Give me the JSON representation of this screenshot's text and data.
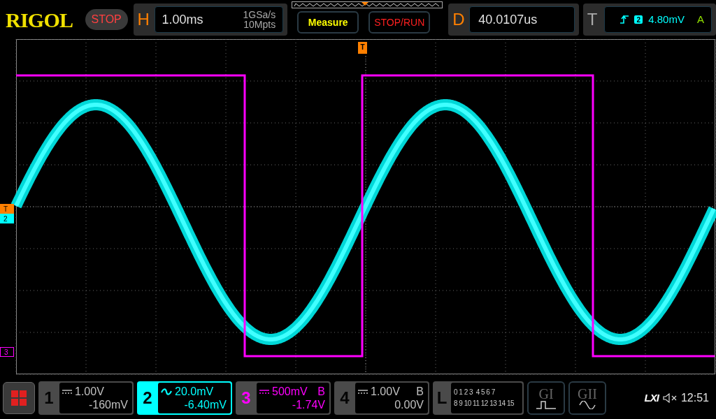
{
  "header": {
    "logo": "RIGOL",
    "run_state": "STOP",
    "horizontal": {
      "label": "H",
      "timebase": "1.00ms",
      "sample_rate": "1GSa/s",
      "memory_depth": "10Mpts"
    },
    "buttons": [
      {
        "label": "Measure",
        "kind": "measure"
      },
      {
        "label": "STOP/RUN",
        "kind": "stoprun"
      }
    ],
    "delay": {
      "label": "D",
      "value": "40.0107us"
    },
    "trigger": {
      "label": "T",
      "source": "2",
      "trigger_level": "4.80mV",
      "mode": "A"
    }
  },
  "plot": {
    "trigger_position_marker": "T",
    "markers": [
      {
        "label": "T",
        "color": "#ff8000"
      },
      {
        "label": "2",
        "color": "#00ffff"
      },
      {
        "label": "3",
        "color": "#ff00ff"
      }
    ]
  },
  "channels": [
    {
      "number": "1",
      "kind": "dc",
      "scale": "1.00V",
      "offset": "-160mV",
      "enabled": false,
      "selected": false
    },
    {
      "number": "2",
      "kind": "ac",
      "scale": "20.0mV",
      "offset": "-6.40mV",
      "enabled": true,
      "selected": true,
      "color": "#00ffff"
    },
    {
      "number": "3",
      "kind": "dc",
      "scale": "500mV",
      "offset": "-1.74V",
      "bandwidth": "B",
      "enabled": true,
      "selected": false,
      "color": "#ff00ff"
    },
    {
      "number": "4",
      "kind": "dc",
      "scale": "1.00V",
      "offset": "0.00V",
      "bandwidth": "B",
      "enabled": false,
      "selected": false
    }
  ],
  "logic": {
    "label": "L",
    "rows": [
      "0 1 2 3  4 5 6 7",
      "8 9 10 11 12 13 14 15"
    ]
  },
  "generators": [
    {
      "label": "GI",
      "kind": "pulse"
    },
    {
      "label": "GII",
      "kind": "sine"
    }
  ],
  "status": {
    "lxi": "LXI",
    "muted": true,
    "time": "12:51"
  }
}
